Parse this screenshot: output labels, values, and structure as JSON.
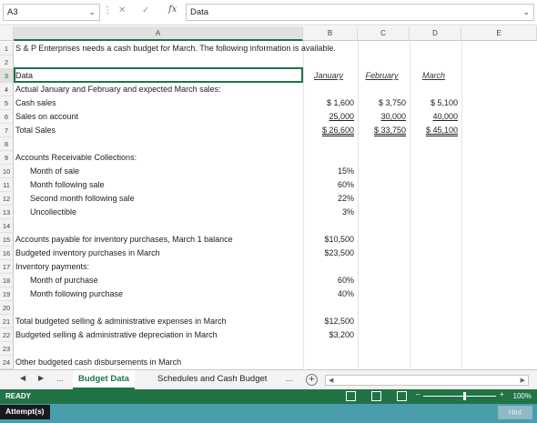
{
  "formula_bar": {
    "name_box": "A3",
    "content": "Data",
    "fx": "fx"
  },
  "columns": [
    "A",
    "B",
    "C",
    "D",
    "E"
  ],
  "rows": [
    {
      "n": "1",
      "a": "S & P Enterprises needs a cash budget for March. The following information is available.",
      "b": "",
      "c": "",
      "d": ""
    },
    {
      "n": "2",
      "a": "",
      "b": "",
      "c": "",
      "d": ""
    },
    {
      "n": "3",
      "a": "Data",
      "b": "January",
      "c": "February",
      "d": "March"
    },
    {
      "n": "4",
      "a": "Actual January and February and expected March sales:",
      "b": "",
      "c": "",
      "d": ""
    },
    {
      "n": "5",
      "a": "Cash sales",
      "b": "$     1,600",
      "c": "$     3,750",
      "d": "$     5,100"
    },
    {
      "n": "6",
      "a": "Sales on account",
      "b": "25,000",
      "c": "30,000",
      "d": "40,000"
    },
    {
      "n": "7",
      "a": "Total Sales",
      "b": "$   26,600",
      "c": "$   33,750",
      "d": "$   45,100"
    },
    {
      "n": "8",
      "a": "",
      "b": "",
      "c": "",
      "d": ""
    },
    {
      "n": "9",
      "a": "Accounts Receivable Collections:",
      "b": "",
      "c": "",
      "d": ""
    },
    {
      "n": "10",
      "a": "Month of sale",
      "b": "15%",
      "c": "",
      "d": ""
    },
    {
      "n": "11",
      "a": "Month following sale",
      "b": "60%",
      "c": "",
      "d": ""
    },
    {
      "n": "12",
      "a": "Second month following sale",
      "b": "22%",
      "c": "",
      "d": ""
    },
    {
      "n": "13",
      "a": "Uncollectible",
      "b": "3%",
      "c": "",
      "d": ""
    },
    {
      "n": "14",
      "a": "",
      "b": "",
      "c": "",
      "d": ""
    },
    {
      "n": "15",
      "a": "Accounts payable for inventory purchases, March 1 balance",
      "b": "$10,500",
      "c": "",
      "d": ""
    },
    {
      "n": "16",
      "a": "Budgeted inventory purchases in March",
      "b": "$23,500",
      "c": "",
      "d": ""
    },
    {
      "n": "17",
      "a": "Inventory payments:",
      "b": "",
      "c": "",
      "d": ""
    },
    {
      "n": "18",
      "a": "Month of purchase",
      "b": "60%",
      "c": "",
      "d": ""
    },
    {
      "n": "19",
      "a": "Month following purchase",
      "b": "40%",
      "c": "",
      "d": ""
    },
    {
      "n": "20",
      "a": "",
      "b": "",
      "c": "",
      "d": ""
    },
    {
      "n": "21",
      "a": "Total budgeted selling & administrative expenses in March",
      "b": "$12,500",
      "c": "",
      "d": ""
    },
    {
      "n": "22",
      "a": "Budgeted selling & administrative depreciation in March",
      "b": "$3,200",
      "c": "",
      "d": ""
    },
    {
      "n": "23",
      "a": "",
      "b": "",
      "c": "",
      "d": ""
    },
    {
      "n": "24",
      "a": "Other budgeted cash disbursements in March",
      "b": "",
      "c": "",
      "d": ""
    }
  ],
  "tabs": {
    "ellipsis": "...",
    "active": "Budget Data",
    "other": "Schedules and Cash Budget",
    "more": "..."
  },
  "status": {
    "ready": "READY",
    "zoom": "100%"
  },
  "bottom": {
    "attempt": "Attempt(s)",
    "hint": "Hint"
  }
}
